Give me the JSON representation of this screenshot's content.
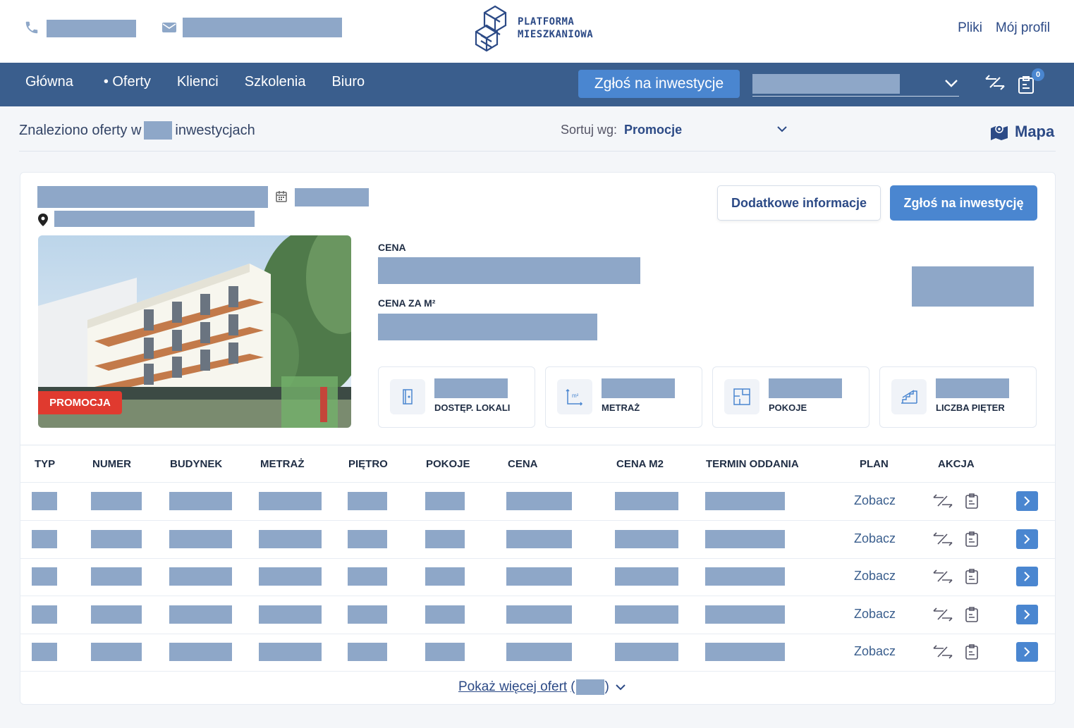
{
  "brand": {
    "line1": "PLATFORMA",
    "line2": "MIESZKANIOWA",
    "color": "#2c4a86"
  },
  "top_links": [
    "Pliki",
    "Mój profil"
  ],
  "nav": {
    "items": [
      "Główna",
      "• Oferty",
      "Klienci",
      "Szkolenia",
      "Biuro"
    ],
    "cta": "Zgłoś na inwestycje",
    "cart_count": "0",
    "bg_color": "#3a5e8d"
  },
  "summary": {
    "prefix": "Znaleziono oferty w",
    "suffix": "inwestycjach"
  },
  "sort": {
    "label": "Sortuj wg:",
    "value": "Promocje"
  },
  "map_label": "Mapa",
  "card": {
    "btn_info": "Dodatkowe informacje",
    "btn_apply": "Zgłoś na inwestycję",
    "promo_badge": "PROMOCJA",
    "price_label": "CENA",
    "price_m2_label": "CENA ZA M²",
    "stats": [
      {
        "icon": "door-icon",
        "caption": "DOSTĘP. LOKALI"
      },
      {
        "icon": "area-icon",
        "caption": "METRAŻ"
      },
      {
        "icon": "floorplan-icon",
        "caption": "POKOJE"
      },
      {
        "icon": "stairs-icon",
        "caption": "LICZBA PIĘTER"
      }
    ]
  },
  "table": {
    "headers": [
      "TYP",
      "NUMER",
      "BUDYNEK",
      "METRAŻ",
      "PIĘTRO",
      "POKOJE",
      "CENA",
      "CENA M2",
      "TERMIN ODDANIA",
      "PLAN",
      "AKCJA"
    ],
    "plan_link": "Zobacz",
    "row_count_label": [
      "Zobacz",
      "Zobacz",
      "Zobacz",
      "Zobacz",
      "Zobacz"
    ]
  },
  "show_more": {
    "label": "Pokaż więcej ofert",
    "open": "(",
    "close": ")"
  },
  "accent": "#4a86d0",
  "promo_color": "#e03a2f"
}
